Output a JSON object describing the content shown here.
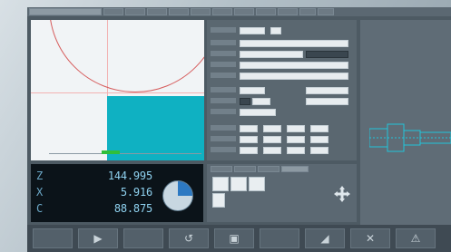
{
  "readout": {
    "rows": [
      {
        "axis": "Z",
        "value": "144.995"
      },
      {
        "axis": "X",
        "value": "5.916"
      },
      {
        "axis": "C",
        "value": "88.875"
      }
    ]
  },
  "colors": {
    "workpiece": "#0fb1c2",
    "readout_text": "#8fd2f0",
    "pie_fill": "#2d79c2"
  },
  "icons": {
    "softkey_icons": [
      "",
      "",
      "play-icon",
      "",
      "cycle-icon",
      "window-icon",
      "",
      "mountain-icon",
      "triangle-icon",
      "close-icon",
      "warning-icon",
      ""
    ]
  }
}
